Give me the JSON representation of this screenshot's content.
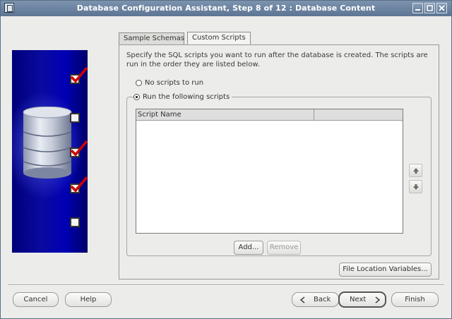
{
  "window": {
    "title": "Database Configuration Assistant, Step 8 of 12 : Database Content"
  },
  "sidebar": {
    "steps": [
      {
        "state": "checked"
      },
      {
        "state": "unchecked"
      },
      {
        "state": "checked"
      },
      {
        "state": "checked"
      },
      {
        "state": "unchecked"
      }
    ]
  },
  "tabs": [
    {
      "label": "Sample Schemas",
      "active": false
    },
    {
      "label": "Custom Scripts",
      "active": true
    }
  ],
  "panel": {
    "description": "Specify the SQL scripts you want to run after the database is created. The scripts are run in the order they are listed below.",
    "options": {
      "no_scripts": "No scripts to run",
      "run_scripts": "Run the following scripts"
    },
    "selected_option": "run_scripts",
    "table": {
      "columns": [
        "Script Name",
        ""
      ],
      "rows": []
    },
    "add_label": "Add...",
    "remove_label": "Remove",
    "file_location_label": "File Location Variables..."
  },
  "footer": {
    "cancel_label": "Cancel",
    "help_label": "Help",
    "back_label": "Back",
    "next_label": "Next",
    "finish_label": "Finish"
  },
  "colors": {
    "titlebar": "#6a82a0",
    "sidebar_bg": "#0000a8",
    "check_mark": "#d40000"
  }
}
